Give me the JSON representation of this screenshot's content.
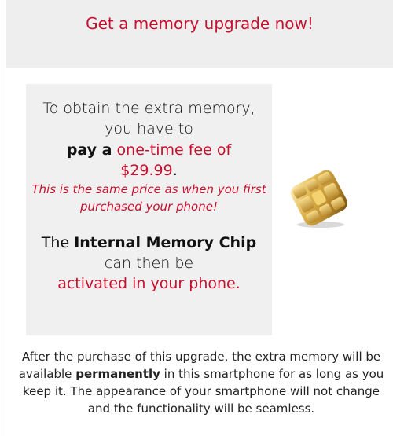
{
  "header": {
    "title": "Get a memory upgrade now!"
  },
  "offer": {
    "line1": "To obtain the extra memory,",
    "line2": "you have to",
    "pay_prefix": "pay a",
    "fee_text": "one-time fee of",
    "price": "$29.99",
    "price_suffix": ".",
    "note": "This is the same price as when you first purchased your phone!",
    "chip_intro": "The",
    "chip_name": "Internal Memory Chip",
    "line_can": "can then be",
    "line_activate": "activated in your phone."
  },
  "footer": {
    "part1": "After the purchase of this upgrade, the extra memory will be available",
    "strong": "permanently",
    "part2": "in this smartphone for as long as you keep it. The appearance of your smartphone will not change and the functionality will be seamless."
  },
  "icons": {
    "chip": "memory-chip-icon"
  },
  "colors": {
    "accent": "#c8102e",
    "panel": "#eeeeee"
  }
}
